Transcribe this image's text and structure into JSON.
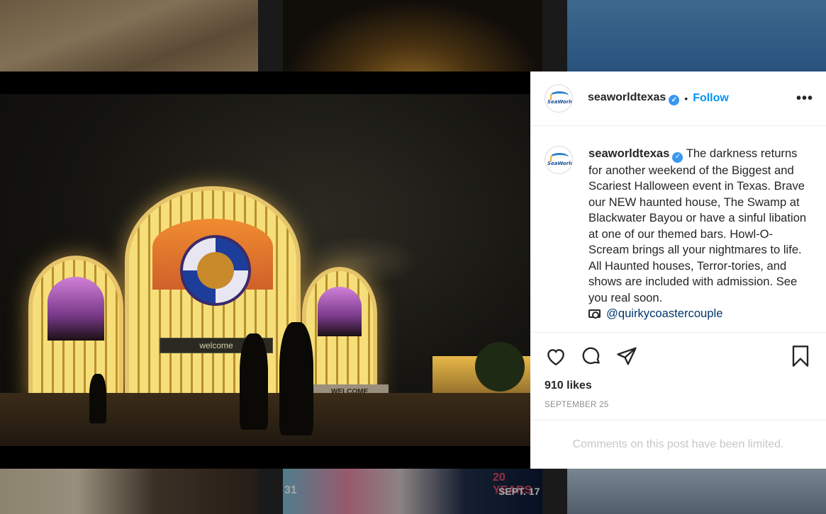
{
  "post": {
    "username": "seaworldtexas",
    "logo_text": "SeaWorld",
    "follow_label": "Follow",
    "more_label": "•••",
    "caption_text": "The darkness returns for another weekend of the Biggest and Scariest Halloween event in Texas. Brave our NEW haunted house, The Swamp at Blackwater Bayou or have a sinful libation at one of our themed bars. Howl-O-Scream brings all your nightmares to life. All Haunted houses, Terror-tories, and shows are included with admission. See you real soon.",
    "mention": "@quirkycoastercouple",
    "likes": "910 likes",
    "date": "SEPTEMBER 25",
    "comments_limited": "Comments on this post have been limited."
  },
  "photo": {
    "sign_text": "welcome",
    "sign2_text": "WELCOME"
  },
  "grid": {
    "bottom_mid_text": "20 YEARS",
    "bottom_mid_date": "SEPT. 17",
    "bottom_mid_num": "31"
  },
  "colors": {
    "accent": "#0095f6",
    "verified": "#3897f0",
    "text": "#262626",
    "muted": "#8e8e8e"
  },
  "icons": [
    "heart-icon",
    "comment-icon",
    "share-icon",
    "bookmark-icon",
    "camera-icon",
    "verified-badge-icon",
    "more-icon"
  ]
}
